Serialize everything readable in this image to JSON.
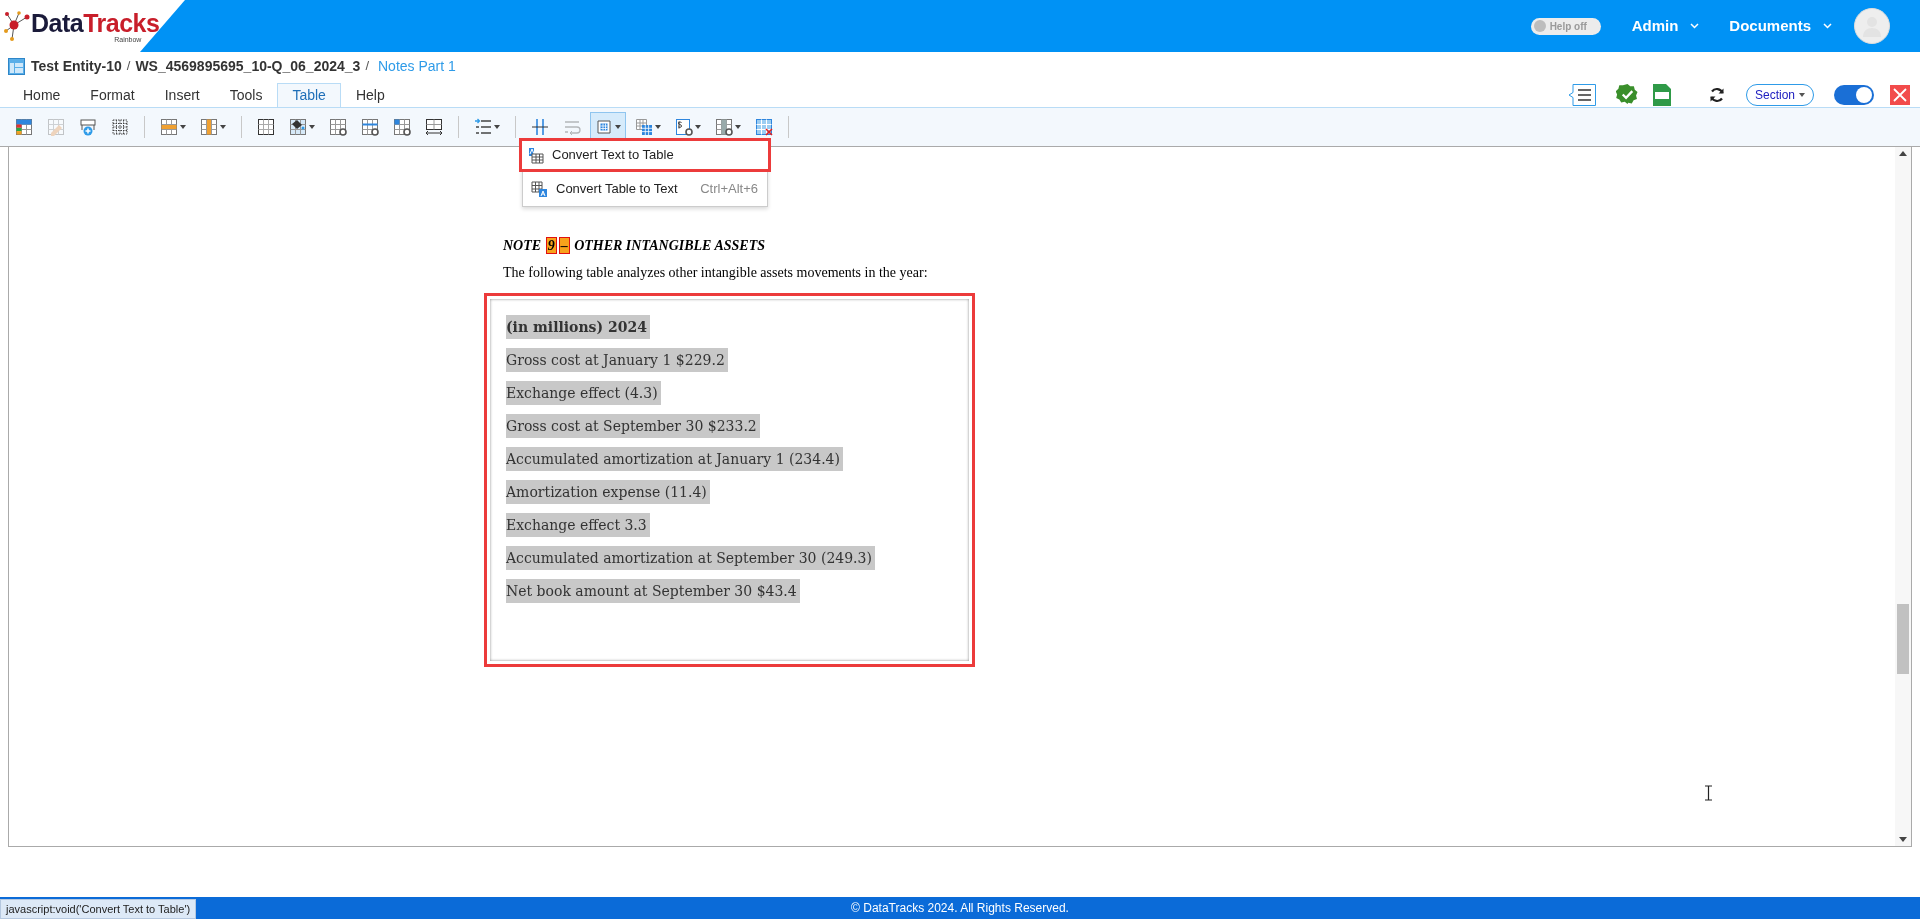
{
  "header": {
    "logo": {
      "word_dark": "Data",
      "word_red": "Tracks",
      "tagline": "Rainbow"
    },
    "help_toggle": {
      "label": "Help off",
      "on": false
    },
    "menus": [
      {
        "label": "Admin"
      },
      {
        "label": "Documents"
      }
    ]
  },
  "breadcrumb": [
    {
      "kind": "plain",
      "label": "Test Entity-10"
    },
    {
      "kind": "separator",
      "label": "/"
    },
    {
      "kind": "plain",
      "label": "WS_4569895695_10-Q_06_2024_3"
    },
    {
      "kind": "separator",
      "label": "/"
    },
    {
      "kind": "link",
      "label": "Notes Part 1"
    }
  ],
  "ribbon_tabs": [
    {
      "label": "Home",
      "selected": false
    },
    {
      "label": "Format",
      "selected": false
    },
    {
      "label": "Insert",
      "selected": false
    },
    {
      "label": "Tools",
      "selected": false
    },
    {
      "label": "Table",
      "selected": true
    },
    {
      "label": "Help",
      "selected": false
    }
  ],
  "actions": {
    "section_select": {
      "label": "Section"
    },
    "edit_toggle": {
      "on": true
    }
  },
  "toolbar": [
    {
      "kind": "button",
      "dropdown": false,
      "selected": false,
      "disabled": false
    },
    {
      "kind": "button",
      "dropdown": false,
      "selected": false,
      "disabled": true
    },
    {
      "kind": "button",
      "dropdown": false,
      "selected": false,
      "disabled": false
    },
    {
      "kind": "button",
      "dropdown": false,
      "selected": false,
      "disabled": false
    },
    {
      "kind": "separator"
    },
    {
      "kind": "button",
      "dropdown": true,
      "selected": false,
      "disabled": false
    },
    {
      "kind": "button",
      "dropdown": true,
      "selected": false,
      "disabled": false
    },
    {
      "kind": "separator"
    },
    {
      "kind": "button",
      "dropdown": false,
      "selected": false,
      "disabled": false
    },
    {
      "kind": "button",
      "dropdown": true,
      "selected": false,
      "disabled": false
    },
    {
      "kind": "button",
      "dropdown": false,
      "selected": false,
      "disabled": false
    },
    {
      "kind": "button",
      "dropdown": false,
      "selected": false,
      "disabled": false
    },
    {
      "kind": "button",
      "dropdown": false,
      "selected": false,
      "disabled": false
    },
    {
      "kind": "button",
      "dropdown": false,
      "selected": false,
      "disabled": false
    },
    {
      "kind": "separator"
    },
    {
      "kind": "button",
      "dropdown": true,
      "selected": false,
      "disabled": false
    },
    {
      "kind": "separator"
    },
    {
      "kind": "button",
      "dropdown": false,
      "selected": false,
      "disabled": false
    },
    {
      "kind": "button",
      "dropdown": false,
      "selected": false,
      "disabled": true
    },
    {
      "kind": "button",
      "dropdown": true,
      "selected": true,
      "disabled": false
    },
    {
      "kind": "button",
      "dropdown": true,
      "selected": false,
      "disabled": false
    },
    {
      "kind": "button",
      "dropdown": true,
      "selected": false,
      "disabled": false
    },
    {
      "kind": "button",
      "dropdown": true,
      "selected": false,
      "disabled": false
    },
    {
      "kind": "button",
      "dropdown": false,
      "selected": false,
      "disabled": false
    },
    {
      "kind": "separator"
    }
  ],
  "dropdown_menu": [
    {
      "label": "Convert Text to Table",
      "highlighted": true
    },
    {
      "label": "Convert Table to Text",
      "shortcut": "Ctrl+Alt+6",
      "highlighted": false
    }
  ],
  "document": {
    "title_segments": [
      {
        "text": "NOTE ",
        "highlighted": false
      },
      {
        "text": "9",
        "highlighted": true
      },
      {
        "text": "–",
        "highlighted": true
      },
      {
        "text": " OTHER INTANGIBLE ASSETS",
        "highlighted": false
      }
    ],
    "intro": "The following table analyzes other intangible assets movements in the year:",
    "block": {
      "highlighted": true,
      "lines": [
        {
          "text": "(in millions) 2024",
          "bold": true,
          "selected": true
        },
        {
          "text": "Gross cost at January 1 $229.2",
          "bold": false,
          "selected": true
        },
        {
          "text": "Exchange effect (4.3)",
          "bold": false,
          "selected": true
        },
        {
          "text": "Gross cost at September 30 $233.2",
          "bold": false,
          "selected": true
        },
        {
          "text": "Accumulated amortization at January 1 (234.4)",
          "bold": false,
          "selected": true
        },
        {
          "text": "Amortization expense (11.4)",
          "bold": false,
          "selected": true
        },
        {
          "text": "Exchange effect 3.3",
          "bold": false,
          "selected": true
        },
        {
          "text": "Accumulated amortization at September 30 (249.3)",
          "bold": false,
          "selected": true
        },
        {
          "text": "Net book amount at September 30 $43.4",
          "bold": false,
          "selected": true
        }
      ]
    }
  },
  "status_tooltip": "javascript:void('Convert Text to Table')",
  "footer": "© DataTracks 2024. All Rights Reserved."
}
